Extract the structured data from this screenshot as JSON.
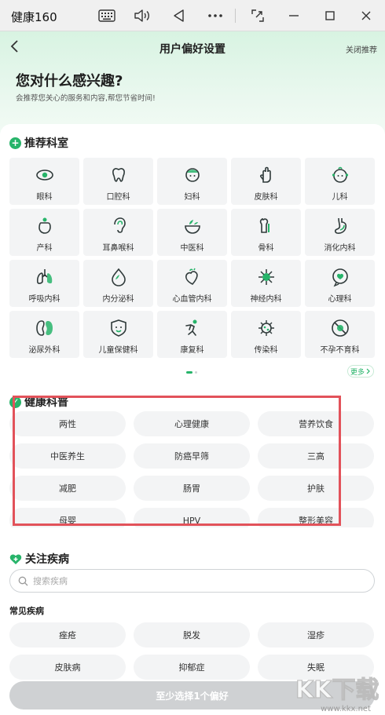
{
  "window": {
    "app_title": "健康160",
    "icons": [
      "keyboard-icon",
      "volume-icon",
      "back-triangle-icon",
      "more-icon",
      "screenshot-icon",
      "minimize-icon",
      "maximize-icon",
      "close-icon"
    ]
  },
  "header": {
    "title": "用户偏好设置",
    "close_recommend": "关闭推荐",
    "hero_title": "您对什么感兴趣?",
    "hero_subtitle": "会推荐您关心的服务和内容,帮您节省时间!"
  },
  "departments": {
    "title": "推荐科室",
    "items": [
      {
        "label": "眼科",
        "icon": "eye-icon"
      },
      {
        "label": "口腔科",
        "icon": "tooth-icon"
      },
      {
        "label": "妇科",
        "icon": "woman-icon"
      },
      {
        "label": "皮肤科",
        "icon": "hand-icon"
      },
      {
        "label": "儿科",
        "icon": "baby-icon"
      },
      {
        "label": "产科",
        "icon": "pregnancy-icon"
      },
      {
        "label": "耳鼻喉科",
        "icon": "ear-icon"
      },
      {
        "label": "中医科",
        "icon": "herbal-bowl-icon"
      },
      {
        "label": "骨科",
        "icon": "bone-icon"
      },
      {
        "label": "消化内科",
        "icon": "stomach-icon"
      },
      {
        "label": "呼吸内科",
        "icon": "lungs-icon"
      },
      {
        "label": "内分泌科",
        "icon": "droplet-icon"
      },
      {
        "label": "心血管内科",
        "icon": "heart-organ-icon"
      },
      {
        "label": "神经内科",
        "icon": "neuron-icon"
      },
      {
        "label": "心理科",
        "icon": "mind-heart-icon"
      },
      {
        "label": "泌尿外科",
        "icon": "kidney-icon"
      },
      {
        "label": "儿童保健科",
        "icon": "child-shield-icon"
      },
      {
        "label": "康复科",
        "icon": "rehab-icon"
      },
      {
        "label": "传染科",
        "icon": "virus-icon"
      },
      {
        "label": "不孕不育科",
        "icon": "no-pregnancy-icon"
      }
    ],
    "more_label": "更多"
  },
  "health_topics": {
    "title": "健康科普",
    "items": [
      "两性",
      "心理健康",
      "营养饮食",
      "中医养生",
      "防癌早筛",
      "三高",
      "减肥",
      "肠胃",
      "护肤",
      "母婴",
      "HPV",
      "整形美容"
    ]
  },
  "diseases": {
    "title": "关注疾病",
    "search_placeholder": "搜索疾病",
    "common_title": "常见疾病",
    "items": [
      "痤疮",
      "脱发",
      "湿疹",
      "皮肤病",
      "抑郁症",
      "失眠"
    ]
  },
  "footer": {
    "cta_label": "至少选择1个偏好"
  },
  "watermark": {
    "text": "KK下载",
    "site": "www.kkx.net"
  },
  "colors": {
    "accent": "#27b46a",
    "highlight": "#e2525a",
    "tile_bg": "#f3f4f5"
  }
}
